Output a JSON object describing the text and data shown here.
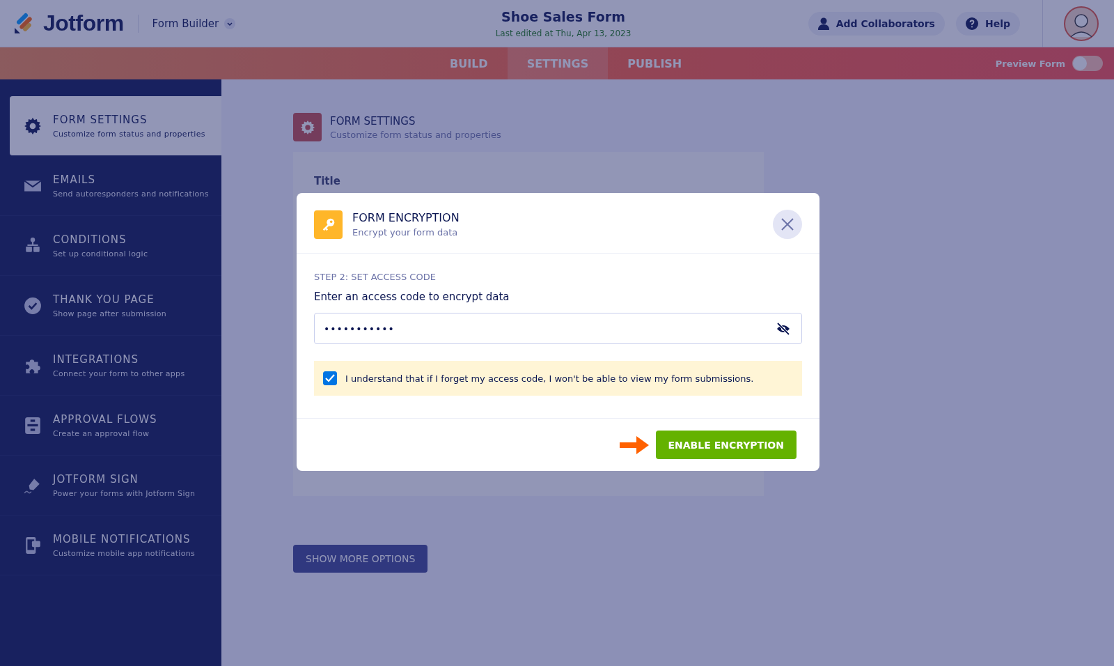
{
  "header": {
    "logo": "Jotform",
    "app_menu": "Form Builder",
    "form_title": "Shoe Sales Form",
    "last_edited": "Last edited at Thu, Apr 13, 2023",
    "collaborators_button": "Add Collaborators",
    "help_button": "Help"
  },
  "tabs": [
    {
      "label": "BUILD",
      "selected": false
    },
    {
      "label": "SETTINGS",
      "selected": true
    },
    {
      "label": "PUBLISH",
      "selected": false
    }
  ],
  "preview": {
    "label": "Preview Form",
    "on": false
  },
  "sidebar": {
    "items": [
      {
        "title": "FORM SETTINGS",
        "subtitle": "Customize form status and properties",
        "selected": true
      },
      {
        "title": "EMAILS",
        "subtitle": "Send autoresponders and notifications",
        "selected": false
      },
      {
        "title": "CONDITIONS",
        "subtitle": "Set up conditional logic",
        "selected": false
      },
      {
        "title": "THANK YOU PAGE",
        "subtitle": "Show page after submission",
        "selected": false
      },
      {
        "title": "INTEGRATIONS",
        "subtitle": "Connect your form to other apps",
        "selected": false
      },
      {
        "title": "APPROVAL FLOWS",
        "subtitle": "Create an approval flow",
        "selected": false
      },
      {
        "title": "JOTFORM SIGN",
        "subtitle": "Power your forms with Jotform Sign",
        "selected": false
      },
      {
        "title": "MOBILE NOTIFICATIONS",
        "subtitle": "Customize mobile app notifications",
        "selected": false
      }
    ]
  },
  "main": {
    "title": "FORM SETTINGS",
    "subtitle": "Customize form status and properties",
    "card_label": "Title",
    "more_button": "SHOW MORE OPTIONS"
  },
  "modal": {
    "title": "FORM ENCRYPTION",
    "subtitle": "Encrypt your form data",
    "step": "STEP 2: SET ACCESS CODE",
    "prompt": "Enter an access code to encrypt data",
    "access_code": "•••••••••••",
    "acknowledge": {
      "label": "I understand that if I forget my access code, I won't be able to view my form submissions.",
      "checked": true
    },
    "primary_button": "ENABLE ENCRYPTION"
  }
}
